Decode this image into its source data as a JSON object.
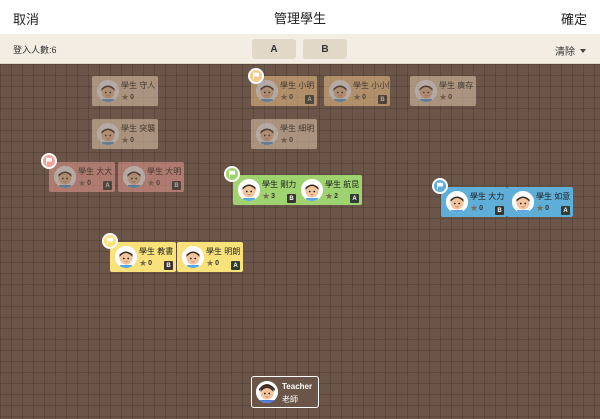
{
  "header": {
    "cancel": "取消",
    "title": "管理學生",
    "confirm": "確定"
  },
  "subbar": {
    "login_count": "登入人數:6",
    "groups": [
      "A",
      "B"
    ],
    "clear": "清除"
  },
  "colors": {
    "beige": "#ead3b6",
    "orange": "#f6c98e",
    "red": "#f2a19a",
    "green": "#9fd36f",
    "blue": "#5eaed8",
    "yellow": "#f9e27a"
  },
  "students": [
    {
      "name": "學生 守人",
      "stars": "0",
      "color": "beige",
      "faded": true
    },
    {
      "name": "學生 小明",
      "stars": "0",
      "color": "orange",
      "faded": true,
      "badge": "A"
    },
    {
      "name": "學生 小小情",
      "stars": "0",
      "color": "orange",
      "faded": true,
      "badge": "B"
    },
    {
      "name": "學生 廣存",
      "stars": "0",
      "color": "beige",
      "faded": true
    },
    {
      "name": "學生 突襲",
      "stars": "0",
      "color": "beige",
      "faded": true
    },
    {
      "name": "學生 細明",
      "stars": "0",
      "color": "beige",
      "faded": true
    },
    {
      "name": "學生 大大",
      "stars": "0",
      "color": "red",
      "faded": true,
      "badge": "A"
    },
    {
      "name": "學生 大明",
      "stars": "0",
      "color": "red",
      "faded": true,
      "badge": "B"
    },
    {
      "name": "學生 剛力",
      "stars": "3",
      "color": "green",
      "faded": false,
      "badge": "B"
    },
    {
      "name": "學生 航昆",
      "stars": "2",
      "color": "green",
      "faded": false,
      "badge": "A"
    },
    {
      "name": "學生 大力",
      "stars": "0",
      "color": "blue",
      "faded": false,
      "badge": "B"
    },
    {
      "name": "學生 如意",
      "stars": "0",
      "color": "blue",
      "faded": false,
      "badge": "A"
    },
    {
      "name": "學生 教書",
      "stars": "0",
      "color": "yellow",
      "faded": false,
      "badge": "B"
    },
    {
      "name": "學生 明朗",
      "stars": "0",
      "color": "yellow",
      "faded": false,
      "badge": "A"
    }
  ],
  "group_flags": [
    {
      "color": "orange"
    },
    {
      "color": "red"
    },
    {
      "color": "green"
    },
    {
      "color": "blue"
    },
    {
      "color": "yellow"
    }
  ],
  "teacher": {
    "name": "Teacher",
    "role": "老師"
  }
}
